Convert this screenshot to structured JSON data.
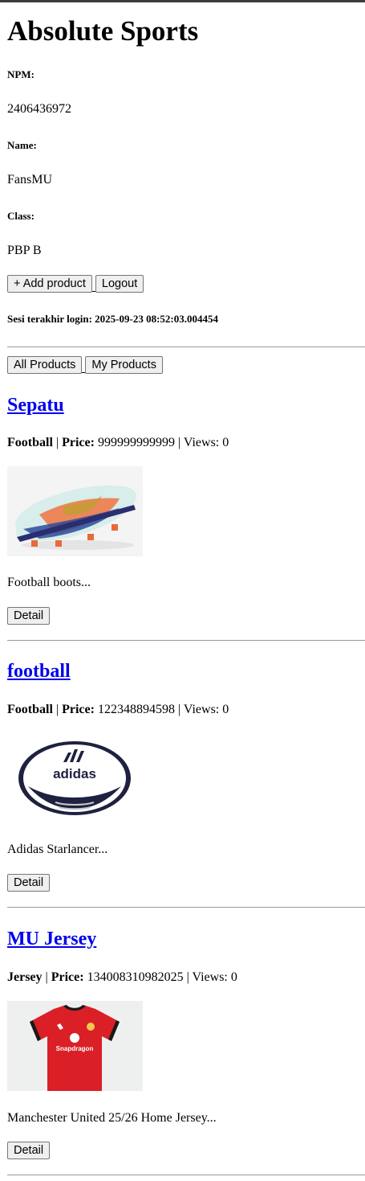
{
  "header": {
    "title": "Absolute Sports",
    "npm_label": "NPM:",
    "npm_value": "2406436972",
    "name_label": "Name:",
    "name_value": "FansMU",
    "class_label": "Class:",
    "class_value": "PBP B"
  },
  "actions": {
    "add_product_label": "+ Add product",
    "logout_label": "Logout"
  },
  "session": {
    "last_login_text": "Sesi terakhir login: 2025-09-23 08:52:03.004454"
  },
  "filters": {
    "all_products_label": "All Products",
    "my_products_label": "My Products"
  },
  "products": [
    {
      "name": "Sepatu",
      "category": "Football",
      "price_label": "Price:",
      "price": "999999999999",
      "views_text": "| Views: 0",
      "description": "Football boots...",
      "detail_label": "Detail",
      "image_icon": "football-boot-image"
    },
    {
      "name": "football",
      "category": "Football",
      "price_label": "Price:",
      "price": "122348894598",
      "views_text": "| Views: 0",
      "description": "Adidas Starlancer...",
      "detail_label": "Detail",
      "image_icon": "soccer-ball-image",
      "image_brand_text": "adidas"
    },
    {
      "name": "MU Jersey",
      "category": "Jersey",
      "price_label": "Price:",
      "price": "134008310982025",
      "views_text": "| Views: 0",
      "description": "Manchester United 25/26 Home Jersey...",
      "detail_label": "Detail",
      "image_icon": "football-jersey-image",
      "image_sponsor_text": "Snapdragon"
    }
  ],
  "colors": {
    "link": "#0000ee",
    "jersey_red": "#da1f26",
    "boot_orange": "#f07a4a",
    "boot_blue": "#2c4a9a"
  }
}
